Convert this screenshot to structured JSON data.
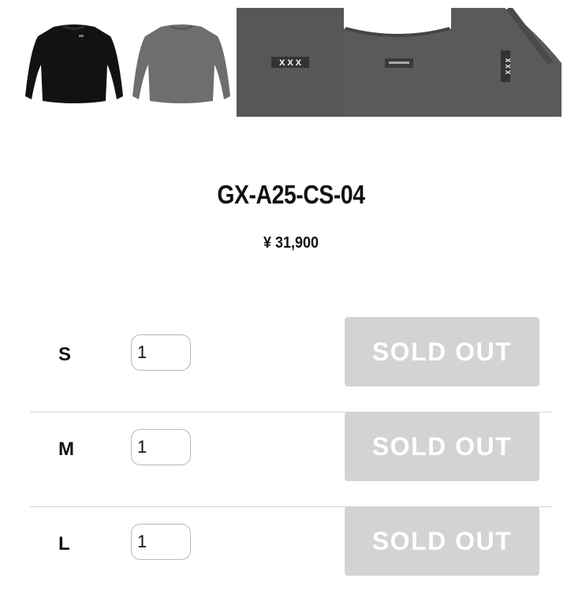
{
  "gallery": {
    "images": [
      {
        "name": "black-sweatshirt",
        "color": "#121212"
      },
      {
        "name": "gray-sweatshirt",
        "color": "#6e6e6e"
      },
      {
        "name": "sweatshirt-detail",
        "color": "#5c5c5c"
      }
    ],
    "detail_tags": {
      "tag_left": "X X X",
      "tag_side": "X X X"
    }
  },
  "product": {
    "title": "GX-A25-CS-04",
    "price": "¥ 31,900"
  },
  "sizes": [
    {
      "label": "S",
      "quantity": "1",
      "button_label": "SOLD OUT"
    },
    {
      "label": "M",
      "quantity": "1",
      "button_label": "SOLD OUT"
    },
    {
      "label": "L",
      "quantity": "1",
      "button_label": "SOLD OUT"
    }
  ],
  "colors": {
    "sold_out_bg": "#d3d3d3",
    "sold_out_text": "#ffffff",
    "divider": "#d6d6d6"
  }
}
